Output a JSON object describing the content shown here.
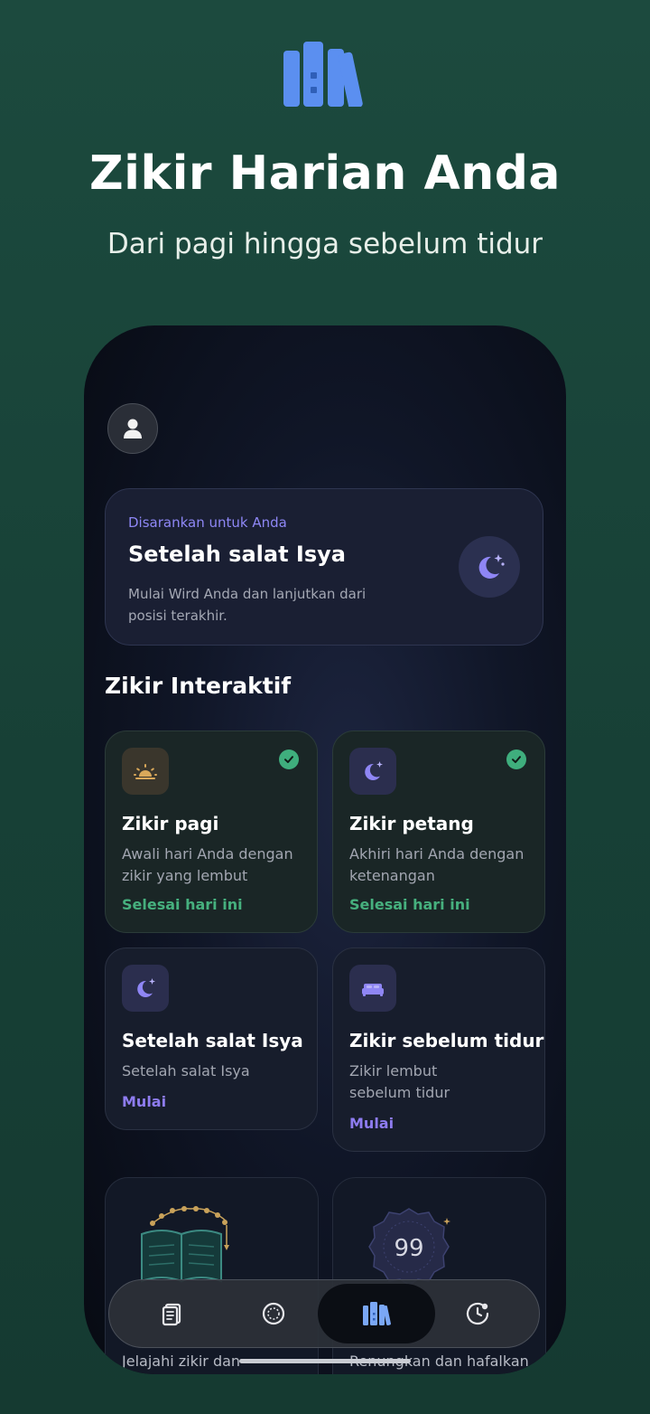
{
  "promo": {
    "icon": "library-books-icon",
    "title": "Zikir Harian Anda",
    "subtitle": "Dari pagi hingga sebelum tidur"
  },
  "header": {
    "avatar_icon": "person-icon"
  },
  "suggestion": {
    "eyebrow": "Disarankan untuk Anda",
    "title": "Setelah salat Isya",
    "description": "Mulai Wird Anda dan lanjutkan dari posisi terakhir.",
    "icon": "moon-stars-icon"
  },
  "section": {
    "title": "Zikir Interaktif"
  },
  "cards": [
    {
      "title": "Zikir pagi",
      "description": "Awali hari Anda dengan zikir yang lembut",
      "status": "Selesai hari ini",
      "icon": "sunrise-icon",
      "completed": true
    },
    {
      "title": "Zikir petang",
      "description": "Akhiri hari Anda dengan ketenangan",
      "status": "Selesai hari ini",
      "icon": "moon-stars-icon",
      "completed": true
    },
    {
      "title": "Setelah salat Isya",
      "description": "Setelah salat Isya",
      "status": "Mulai",
      "icon": "moon-stars-icon",
      "completed": false
    },
    {
      "title": "Zikir sebelum tidur",
      "description": "Zikir lembut sebelum tidur",
      "status": "Mulai",
      "icon": "bed-icon",
      "completed": false
    }
  ],
  "features": [
    {
      "description": "Jelajahi zikir dan",
      "icon": "open-book-prayer-beads-icon"
    },
    {
      "description": "Renungkan dan hafalkan",
      "icon": "names-badge-99-icon",
      "badge_number": "99"
    }
  ],
  "nav": [
    {
      "name": "nav-library",
      "icon": "document-icon",
      "active": false
    },
    {
      "name": "nav-counter",
      "icon": "circle-ring-icon",
      "active": false
    },
    {
      "name": "nav-zikir",
      "icon": "library-books-icon",
      "active": true
    },
    {
      "name": "nav-history",
      "icon": "clock-icon",
      "active": false
    }
  ],
  "colors": {
    "accent_purple": "#8e87f5",
    "status_green": "#46b07e",
    "icon_blue": "#5b8ff0",
    "background": "#1c4a3e"
  }
}
